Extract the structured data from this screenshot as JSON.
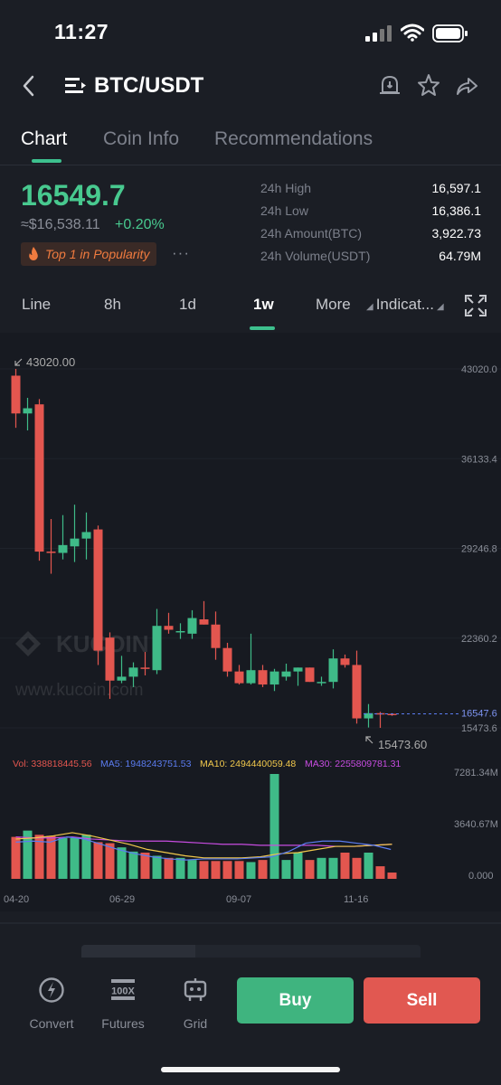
{
  "status_bar": {
    "time": "11:27"
  },
  "nav": {
    "pair": "BTC/USDT"
  },
  "tabs": [
    {
      "label": "Chart",
      "active": true
    },
    {
      "label": "Coin Info",
      "active": false
    },
    {
      "label": "Recommendations",
      "active": false
    }
  ],
  "ticker": {
    "last_price": "16549.7",
    "fiat_price": "≈$16,538.11",
    "change": "+0.20%",
    "badge": "Top 1 in Popularity",
    "more": "···",
    "stats": [
      {
        "label": "24h High",
        "value": "16,597.1"
      },
      {
        "label": "24h Low",
        "value": "16,386.1"
      },
      {
        "label": "24h Amount(BTC)",
        "value": "3,922.73"
      },
      {
        "label": "24h Volume(USDT)",
        "value": "64.79M"
      }
    ]
  },
  "intervals": {
    "line": "Line",
    "h8": "8h",
    "d1": "1d",
    "w1": "1w",
    "more": "More",
    "indicators": "Indicat..."
  },
  "chart_data": {
    "type": "candlestick",
    "price_axis_ticks": [
      "43020.0",
      "36133.4",
      "29246.8",
      "22360.2",
      "15473.6"
    ],
    "current_price_label": "16547.6",
    "max_marker": "43020.00",
    "min_marker": "15473.60",
    "watermark_logo": "KUCOIN",
    "watermark_url": "www.kucoin.com",
    "x_tick_labels": [
      "04-20",
      "06-29",
      "09-07",
      "11-16"
    ],
    "volume_axis_ticks": [
      "7281.34M",
      "3640.67M",
      "0.000"
    ],
    "volume_indicators": {
      "vol": "Vol: 338818445.56",
      "ma5": "MA5: 1948243751.53",
      "ma10": "MA10: 2494440059.48",
      "ma30": "MA30: 2255809781.31"
    },
    "colors": {
      "up": "#3fbb88",
      "down": "#e3564f",
      "ma5": "#5b7cf0",
      "ma10": "#f2c94c",
      "ma30": "#c74ce0",
      "vol_label": "#e3564f"
    },
    "candles": [
      {
        "o": 42500,
        "h": 43020,
        "l": 38500,
        "c": 39600
      },
      {
        "o": 39600,
        "h": 40800,
        "l": 38300,
        "c": 40000
      },
      {
        "o": 40300,
        "h": 40700,
        "l": 28300,
        "c": 29000
      },
      {
        "o": 29000,
        "h": 31500,
        "l": 27300,
        "c": 28900
      },
      {
        "o": 28900,
        "h": 31800,
        "l": 28400,
        "c": 29500
      },
      {
        "o": 29400,
        "h": 32600,
        "l": 28200,
        "c": 30000
      },
      {
        "o": 30000,
        "h": 32000,
        "l": 28400,
        "c": 30500
      },
      {
        "o": 30700,
        "h": 31000,
        "l": 20300,
        "c": 21400
      },
      {
        "o": 22400,
        "h": 22800,
        "l": 17700,
        "c": 19100
      },
      {
        "o": 19100,
        "h": 21000,
        "l": 18900,
        "c": 19400
      },
      {
        "o": 19400,
        "h": 20500,
        "l": 18600,
        "c": 20100
      },
      {
        "o": 20100,
        "h": 21300,
        "l": 19500,
        "c": 20000
      },
      {
        "o": 19900,
        "h": 24600,
        "l": 19600,
        "c": 23300
      },
      {
        "o": 23300,
        "h": 24300,
        "l": 22700,
        "c": 23000
      },
      {
        "o": 22900,
        "h": 23500,
        "l": 22300,
        "c": 22900
      },
      {
        "o": 22700,
        "h": 24500,
        "l": 22300,
        "c": 23900
      },
      {
        "o": 23800,
        "h": 25200,
        "l": 23400,
        "c": 23400
      },
      {
        "o": 23400,
        "h": 24400,
        "l": 20700,
        "c": 21600
      },
      {
        "o": 21600,
        "h": 22000,
        "l": 19400,
        "c": 19800
      },
      {
        "o": 19800,
        "h": 20300,
        "l": 18800,
        "c": 18900
      },
      {
        "o": 18900,
        "h": 22700,
        "l": 18800,
        "c": 19900
      },
      {
        "o": 19900,
        "h": 20300,
        "l": 18600,
        "c": 18800
      },
      {
        "o": 18800,
        "h": 20000,
        "l": 18300,
        "c": 19800
      },
      {
        "o": 19400,
        "h": 20400,
        "l": 19100,
        "c": 19800
      },
      {
        "o": 19800,
        "h": 20100,
        "l": 18700,
        "c": 20100
      },
      {
        "o": 20100,
        "h": 20000,
        "l": 19000,
        "c": 19000
      },
      {
        "o": 19000,
        "h": 19400,
        "l": 18700,
        "c": 19000
      },
      {
        "o": 19000,
        "h": 21500,
        "l": 18500,
        "c": 20800
      },
      {
        "o": 20800,
        "h": 21100,
        "l": 20100,
        "c": 20300
      },
      {
        "o": 20300,
        "h": 21400,
        "l": 15800,
        "c": 16200
      },
      {
        "o": 16200,
        "h": 17300,
        "l": 15500,
        "c": 16600
      },
      {
        "o": 16600,
        "h": 16700,
        "l": 15473,
        "c": 16500
      },
      {
        "o": 16550,
        "h": 16600,
        "l": 16400,
        "c": 16548
      }
    ],
    "volumes": [
      0.4,
      0.46,
      0.42,
      0.41,
      0.39,
      0.39,
      0.42,
      0.35,
      0.34,
      0.3,
      0.26,
      0.25,
      0.22,
      0.2,
      0.2,
      0.18,
      0.17,
      0.17,
      0.17,
      0.17,
      0.16,
      0.18,
      0.2,
      0.18,
      0.25,
      0.18,
      0.2,
      0.2,
      0.25,
      0.2,
      0.25,
      0.12,
      0.06
    ],
    "volume_spike": {
      "index": 22,
      "value": 1.0
    },
    "ma5_line": [
      0.35,
      0.36,
      0.35,
      0.4,
      0.38,
      0.33,
      0.28,
      0.24,
      0.21,
      0.19,
      0.18,
      0.19,
      0.19,
      0.19,
      0.2,
      0.21,
      0.26,
      0.34,
      0.36,
      0.36,
      0.34,
      0.32,
      0.28
    ],
    "ma10_line": [
      0.38,
      0.39,
      0.41,
      0.44,
      0.41,
      0.37,
      0.33,
      0.28,
      0.25,
      0.22,
      0.2,
      0.2,
      0.2,
      0.21,
      0.24,
      0.25,
      0.28,
      0.31,
      0.31,
      0.32,
      0.33
    ],
    "ma30_line": [
      0.4,
      0.39,
      0.39,
      0.4,
      0.38,
      0.37,
      0.36,
      0.36,
      0.36,
      0.35,
      0.34,
      0.33,
      0.33,
      0.32,
      0.32,
      0.32,
      0.32,
      0.31,
      0.31,
      0.32,
      0.33
    ]
  },
  "bottom_bar": {
    "convert": "Convert",
    "futures": "Futures",
    "futures_icon_text": "100X",
    "grid": "Grid",
    "buy": "Buy",
    "sell": "Sell"
  }
}
